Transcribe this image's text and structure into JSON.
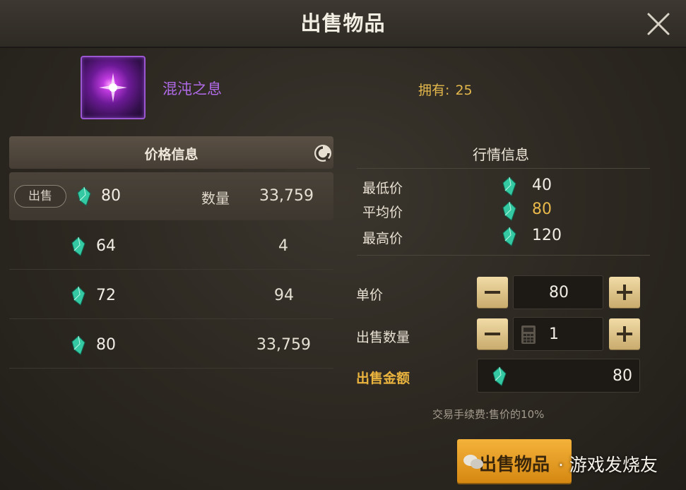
{
  "dialog": {
    "title": "出售物品"
  },
  "item": {
    "name": "混沌之息",
    "owned_label": "拥有:",
    "owned_count": "25"
  },
  "price_panel": {
    "header": "价格信息",
    "sell_tag": "出售",
    "qty_label": "数量",
    "rows": [
      {
        "price": "80",
        "qty": "33,759",
        "selected": true
      },
      {
        "price": "64",
        "qty": "4"
      },
      {
        "price": "72",
        "qty": "94"
      },
      {
        "price": "80",
        "qty": "33,759"
      }
    ]
  },
  "market": {
    "title": "行情信息",
    "min_label": "最低价",
    "min_value": "40",
    "avg_label": "平均价",
    "avg_value": "80",
    "max_label": "最高价",
    "max_value": "120"
  },
  "form": {
    "unit_price_label": "单价",
    "unit_price": "80",
    "qty_label": "出售数量",
    "qty": "1",
    "total_label": "出售金额",
    "total": "80",
    "fee_note": "交易手续费:售价的10%"
  },
  "sell_button": {
    "label": "出售物品"
  },
  "watermark": {
    "text": "· 游戏发烧友"
  },
  "colors": {
    "gold": "#e9b84a",
    "purple": "#b06ae8",
    "button": "#e79f22"
  }
}
